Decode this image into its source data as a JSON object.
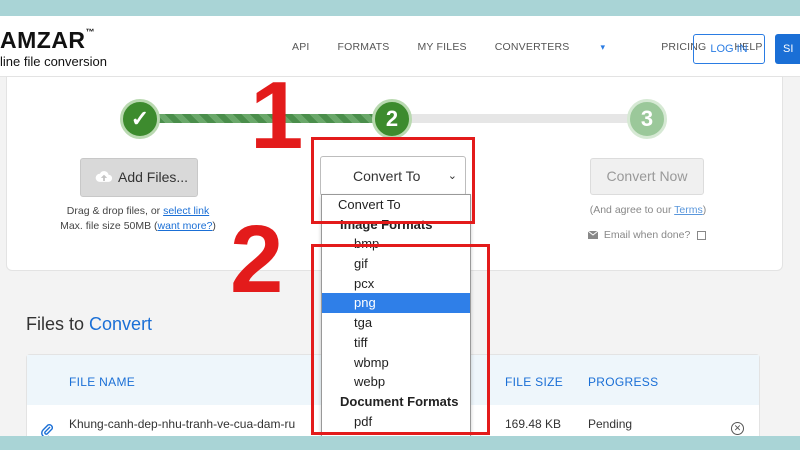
{
  "brand": {
    "name": "AMZAR",
    "trademark": "™",
    "tagline": "line file conversion"
  },
  "nav": {
    "items": [
      "API",
      "FORMATS",
      "MY FILES",
      "CONVERTERS",
      "PRICING",
      "HELP"
    ],
    "converters_caret": "▾",
    "login": "LOG IN",
    "signup": "SI"
  },
  "steps": {
    "step1_glyph": "✓",
    "step2": "2",
    "step3": "3"
  },
  "add_files": {
    "label": "Add Files...",
    "icon": "cloud-upload-icon",
    "drag_text": "Drag & drop files, or",
    "select_link": "select link",
    "max_size_text": "Max. file size 50MB (",
    "want_more": "want more?",
    "want_more_close": ")"
  },
  "convert_to": {
    "value": "Convert To",
    "chevron": "⌄"
  },
  "convert_now": {
    "label": "Convert Now",
    "agree_prefix": "(And agree to our",
    "terms": "Terms",
    "agree_suffix": ")",
    "email_label": "Email when done?",
    "email_icon": "envelope-icon"
  },
  "dropdown": {
    "first": "Convert To",
    "image_header": "Image Formats",
    "image_formats": [
      "bmp",
      "gif",
      "pcx",
      "png",
      "tga",
      "tiff",
      "wbmp",
      "webp"
    ],
    "selected": "png",
    "document_header": "Document Formats",
    "document_formats": [
      "pdf"
    ]
  },
  "files": {
    "title_plain": "Files to ",
    "title_accent": "Convert",
    "columns": [
      "FILE NAME",
      "FILE SIZE",
      "PROGRESS"
    ],
    "rows": [
      {
        "name": "Khung-canh-dep-nhu-tranh-ve-cua-dam-ru",
        "size": "169.48 KB",
        "status": "Pending"
      }
    ]
  },
  "annotations": {
    "label1": "1",
    "label2": "2",
    "color": "#e31b1b"
  }
}
